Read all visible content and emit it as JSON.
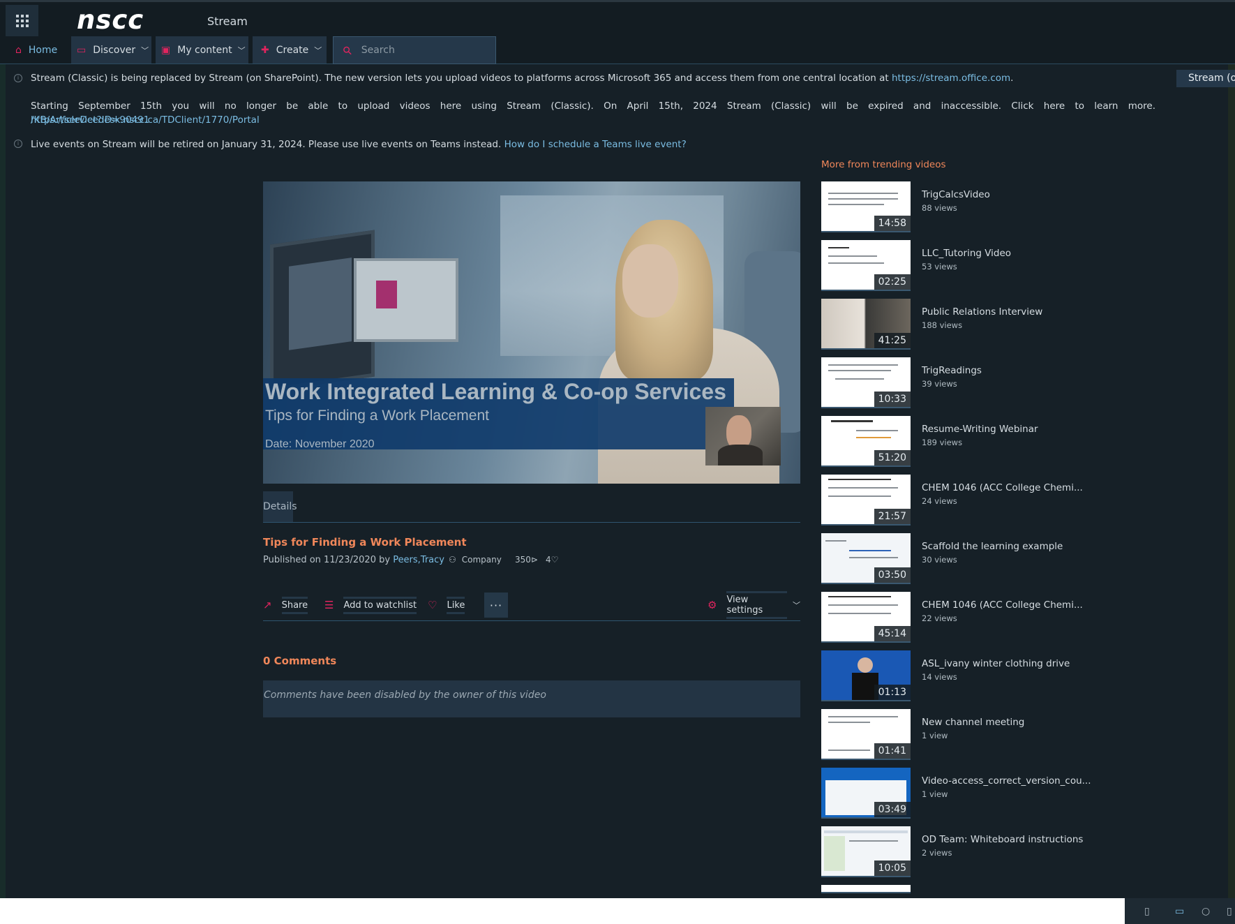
{
  "header": {
    "logo": "nscc",
    "app_name": "Stream"
  },
  "nav": {
    "home": "Home",
    "discover": "Discover",
    "my_content": "My content",
    "create": "Create",
    "search_placeholder": "Search"
  },
  "notices": {
    "notice1_text": "Stream (Classic) is being replaced by Stream (on SharePoint). The new version lets you upload videos to platforms across Microsoft 365 and access them from one central location at ",
    "notice1_link": "https://stream.office.com",
    "notice1_end": ".",
    "stream_new_button": "Stream (on",
    "notice2_text": "Starting September 15th you will no longer be able to upload videos here using Stream (Classic). On April 15th, 2024 Stream (Classic) will be expired and inaccessible. Click here to learn more. ",
    "notice2_link_part1": "https://servicedesk.nscc.ca/TDClient/1770/Portal",
    "notice2_link_part2": "/KB/ArticleDet?ID=90491",
    "notice3_text": "Live events on Stream will be retired on January 31, 2024. Please use live events on Teams instead. ",
    "notice3_link": "How do I schedule a Teams live event?"
  },
  "video": {
    "slide_title": "Work Integrated Learning & Co-op Services",
    "slide_subtitle": "Tips for Finding a Work Placement",
    "slide_date": "Date: November 2020"
  },
  "details": {
    "tab_label": "Details",
    "title": "Tips for Finding a Work Placement",
    "published_prefix": "Published on 11/23/2020 by ",
    "author": "Peers,Tracy",
    "audience": "Company",
    "views": "350",
    "likes": "4"
  },
  "actions": {
    "share": "Share",
    "watchlist": "Add to watchlist",
    "like": "Like",
    "more": "···",
    "view_settings": "View settings"
  },
  "comments": {
    "title": "0 Comments",
    "disabled_message": "Comments have been disabled by the owner of this video"
  },
  "trending": {
    "title": "More from trending videos",
    "items": [
      {
        "title": "TrigCalcsVideo",
        "views": "88 views",
        "duration": "14:58"
      },
      {
        "title": "LLC_Tutoring Video",
        "views": "53 views",
        "duration": "02:25"
      },
      {
        "title": "Public Relations Interview",
        "views": "188 views",
        "duration": "41:25"
      },
      {
        "title": "TrigReadings",
        "views": "39 views",
        "duration": "10:33"
      },
      {
        "title": "Resume-Writing Webinar",
        "views": "189 views",
        "duration": "51:20"
      },
      {
        "title": "CHEM 1046 (ACC College Chemi...",
        "views": "24 views",
        "duration": "21:57"
      },
      {
        "title": "Scaffold the learning example",
        "views": "30 views",
        "duration": "03:50"
      },
      {
        "title": "CHEM 1046 (ACC College Chemi...",
        "views": "22 views",
        "duration": "45:14"
      },
      {
        "title": "ASL_ivany winter clothing drive",
        "views": "14 views",
        "duration": "01:13"
      },
      {
        "title": "New channel meeting",
        "views": "1 view",
        "duration": "01:41"
      },
      {
        "title": "Video-access_correct_version_cou...",
        "views": "1 view",
        "duration": "03:49"
      },
      {
        "title": "OD Team: Whiteboard instructions",
        "views": "2 views",
        "duration": "10:05"
      }
    ]
  }
}
